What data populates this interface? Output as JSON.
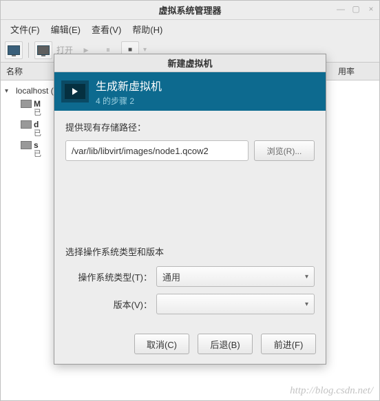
{
  "main": {
    "title": "虚拟系统管理器",
    "menu": {
      "file": "文件(F)",
      "edit": "编辑(E)",
      "view": "查看(V)",
      "help": "帮助(H)"
    },
    "toolbar_open": "打开",
    "columns": {
      "name": "名称",
      "rate": "用率"
    },
    "tree": {
      "host": "localhost (",
      "vms": [
        {
          "name": "M",
          "sub": "已"
        },
        {
          "name": "d",
          "sub": "已"
        },
        {
          "name": "s",
          "sub": "已"
        }
      ]
    }
  },
  "dialog": {
    "title": "新建虚拟机",
    "header_title": "生成新虚拟机",
    "header_step": "4 的步骤 2",
    "path_label": "提供现有存储路径：",
    "path_value": "/var/lib/libvirt/images/node1.qcow2",
    "browse": "浏览(R)...",
    "os_section_title": "选择操作系统类型和版本",
    "os_type_label": "操作系统类型(T)：",
    "os_type_value": "通用",
    "version_label": "版本(V)：",
    "version_value": "",
    "buttons": {
      "cancel": "取消(C)",
      "back": "后退(B)",
      "forward": "前进(F)"
    }
  },
  "watermark": "http://blog.csdn.net/"
}
